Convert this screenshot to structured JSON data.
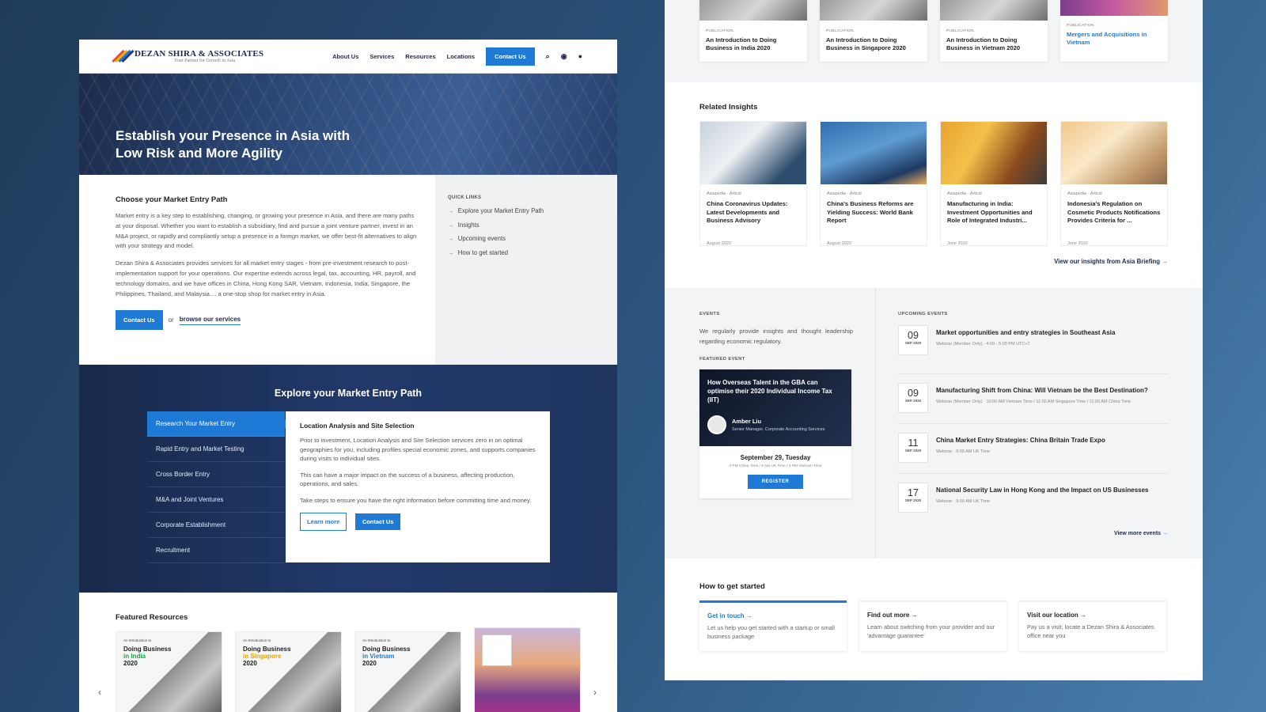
{
  "left": {
    "header": {
      "logo_title": "DEZAN SHIRA & ASSOCIATES",
      "logo_tagline": "Your Partner for Growth in Asia",
      "nav": [
        "About Us",
        "Services",
        "Resources",
        "Locations"
      ],
      "contact_button": "Contact Us"
    },
    "hero": {
      "title": "Establish your Presence in Asia with Low Risk and More Agility"
    },
    "intro": {
      "heading": "Choose your Market Entry Path",
      "para1": "Market entry is a key step to establishing, changing, or growing your presence in Asia, and there are many paths at your disposal. Whether you want to establish a subsidiary, find and pursue a joint venture partner, invest in an M&A project, or rapidly and compliantly setup a presence in a foreign market, we offer best-fit alternatives to align with your strategy and model.",
      "para2": "Dezan Shira & Associates provides services for all market entry stages - from pre-investment research to post-implementation support for your operations. Our expertise extends across legal, tax, accounting, HR, payroll, and technology domains, and we have offices in China, Hong Kong SAR, Vietnam, Indonesia, India, Singapore, the Philippines, Thailand, and Malaysia.... a one-stop shop for market entry in Asia.",
      "contact_button": "Contact Us",
      "or_text": "or",
      "browse_link": "browse our services"
    },
    "quick_links": {
      "title": "QUICK LINKS",
      "items": [
        "Explore your Market Entry Path",
        "Insights",
        "Upcoming events",
        "How to get started"
      ]
    },
    "explore": {
      "heading": "Explore your Market Entry Path",
      "tabs": [
        "Research Your Market Entry",
        "Rapid Entry and Market Testing",
        "Cross Border Entry",
        "M&A and Joint Ventures",
        "Corporate Establishment",
        "Recruitment"
      ],
      "panel_title": "Location Analysis and Site Selection",
      "panel_p1": "Prior to investment, Location Analysis and Site Selection services zero in on optimal geographies for you, including profiles special economic zones, and supports companies during visits to individual sites.",
      "panel_p2": "This can have a major impact on the success of a business, affecting production, operations, and sales.",
      "panel_p3": "Take steps to ensure you have the right information before committing time and money.",
      "learn_more": "Learn more",
      "contact": "Contact Us"
    },
    "featured": {
      "heading": "Featured Resources",
      "cards": [
        {
          "small": "An Introduction to",
          "line1": "Doing Business",
          "line2": "in India",
          "line3": "2020"
        },
        {
          "small": "An Introduction to",
          "line1": "Doing Business",
          "line2": "in Singapore",
          "line3": "2020"
        },
        {
          "small": "An Introduction to",
          "line1": "Doing Business",
          "line2": "in Vietnam",
          "line3": "2020"
        }
      ],
      "prev": "‹",
      "next": "›"
    }
  },
  "right": {
    "publications": [
      {
        "label": "PUBLICATION",
        "title": "An Introduction to Doing Business in India 2020"
      },
      {
        "label": "PUBLICATION",
        "title": "An Introduction to Doing Business in Singapore 2020"
      },
      {
        "label": "PUBLICATION",
        "title": "An Introduction to Doing Business in Vietnam 2020"
      },
      {
        "label": "PUBLICATION",
        "title": "Mergers and Acquisitions in Vietnam"
      }
    ],
    "related": {
      "heading": "Related Insights",
      "cards": [
        {
          "cat": "Asiapedia - Article",
          "title": "China Coronavirus Updates: Latest Developments and Business Advisory",
          "date": "August 2020"
        },
        {
          "cat": "Asiapedia - Article",
          "title": "China's Business Reforms are Yielding Success: World Bank Report",
          "date": "August 2020"
        },
        {
          "cat": "Asiapedia - Article",
          "title": "Manufacturing in India: Investment Opportunities and Role of Integrated Industri...",
          "date": "June 2020"
        },
        {
          "cat": "Asiapedia - Article",
          "title": "Indonesia's Regulation on Cosmetic Products Notifications Provides Criteria for ...",
          "date": "June 2020"
        }
      ],
      "more": "View our insights from Asia Briefing",
      "arrow": "→"
    },
    "events": {
      "caption": "EVENTS",
      "intro": "We regularly provide insights and thought leadership regarding economic regulatory.",
      "featured_caption": "FEATURED EVENT",
      "featured": {
        "title": "How Overseas Talent in the GBA can optimise their 2020 Individual Income Tax (IIT)",
        "speaker": "Amber Liu",
        "role": "Senior Manager, Corporate Accounting Services",
        "date": "September 29, Tuesday",
        "times": "3 PM China Time / 8 AM UK Time / 2 PM Vietnam Time",
        "register": "REGISTER"
      },
      "upcoming_caption": "UPCOMING EVENTS",
      "upcoming": [
        {
          "day": "09",
          "month": "SEP 2020",
          "title": "Market opportunities and entry strategies in Southeast Asia",
          "sub": "Webinar (Member Only)  ·  4:00 - 5:00 PM UTC+7"
        },
        {
          "day": "09",
          "month": "SEP 2020",
          "title": "Manufacturing Shift from China: Will Vietnam be the Best Destination?",
          "sub": "Webinar (Member Only)  ·  10:00 AM Vietnam Time / 11:00 AM Singapore Time / 11:00 AM China Time"
        },
        {
          "day": "11",
          "month": "SEP 2020",
          "title": "China Market Entry Strategies: China Britain Trade Expo",
          "sub": "Webinar  ·  9:00 AM UK Time"
        },
        {
          "day": "17",
          "month": "SEP 2020",
          "title": "National Security Law in Hong Kong and the Impact on US Businesses",
          "sub": "Webinar  ·  9:00 AM UK Time"
        }
      ],
      "more": "View more events",
      "arrow": "→"
    },
    "start": {
      "heading": "How to get started",
      "cards": [
        {
          "title": "Get in touch →",
          "text": "Let us help you get started with a startup or small business package"
        },
        {
          "title": "Find out more →",
          "text": "Learn about switching from your provider and our 'advantage guarantee'"
        },
        {
          "title": "Visit our location →",
          "text": "Pay us a visit, locate a Dezan Shira & Associates office near you"
        }
      ]
    }
  }
}
